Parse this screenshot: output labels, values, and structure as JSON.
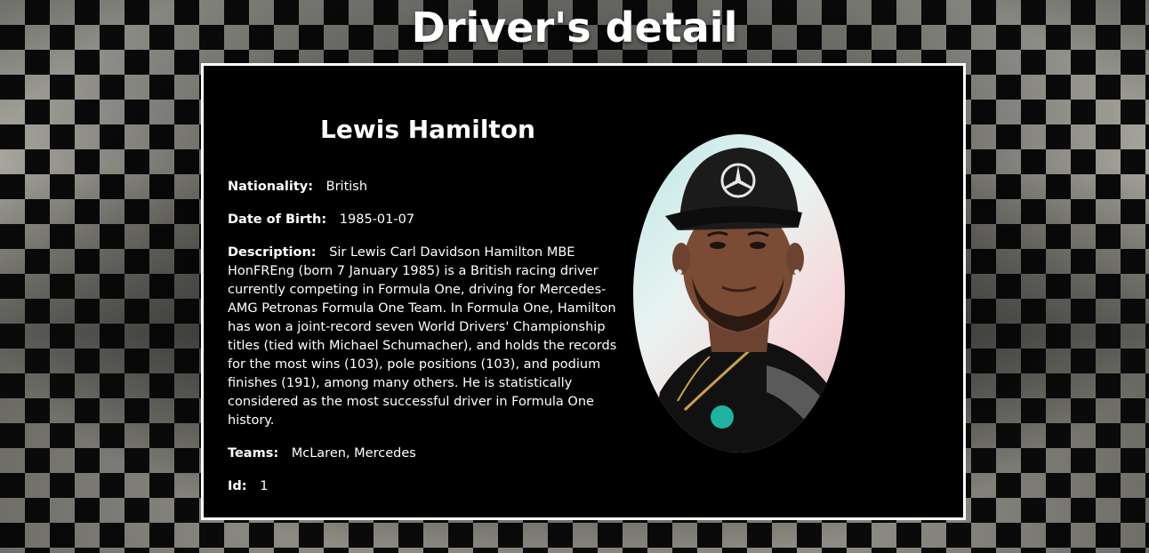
{
  "page": {
    "title": "Driver's detail"
  },
  "driver": {
    "name": "Lewis Hamilton",
    "photo_alt": "Lewis Hamilton",
    "fields": {
      "nationality": {
        "label": "Nationality:",
        "value": "British"
      },
      "date_of_birth": {
        "label": "Date of Birth:",
        "value": "1985-01-07"
      },
      "description": {
        "label": "Description:",
        "value": "Sir Lewis Carl Davidson Hamilton MBE HonFREng (born 7 January 1985) is a British racing driver currently competing in Formula One, driving for Mercedes-AMG Petronas Formula One Team. In Formula One, Hamilton has won a joint-record seven World Drivers' Championship titles (tied with Michael Schumacher), and holds the records for the most wins (103), pole positions (103), and podium finishes (191), among many others. He is statistically considered as the most successful driver in Formula One history."
      },
      "teams": {
        "label": "Teams:",
        "value": "McLaren, Mercedes"
      },
      "id": {
        "label": "Id:",
        "value": "1"
      }
    }
  },
  "colors": {
    "card_background": "#000000",
    "card_border": "#ffffff",
    "text": "#ffffff"
  }
}
